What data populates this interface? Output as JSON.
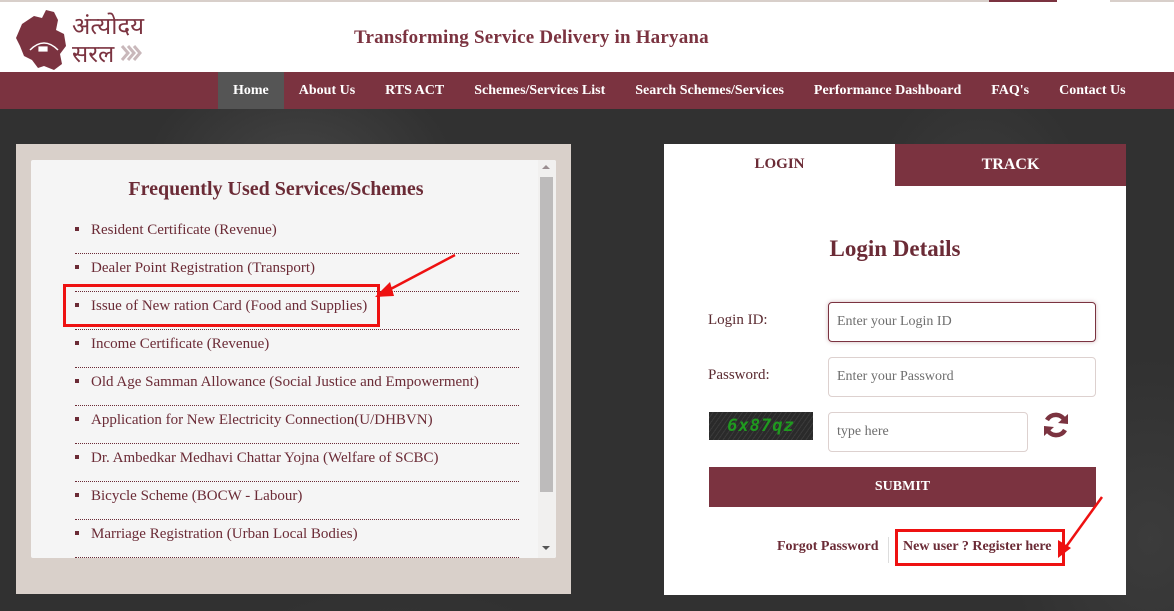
{
  "header": {
    "logo_text_line1": "अंत्योदय",
    "logo_text_line2": "सरल",
    "tagline": "Transforming Service Delivery in Haryana"
  },
  "nav": {
    "items": [
      {
        "label": "Home",
        "active": true
      },
      {
        "label": "About Us"
      },
      {
        "label": "RTS ACT"
      },
      {
        "label": "Schemes/Services List"
      },
      {
        "label": "Search Schemes/Services"
      },
      {
        "label": "Performance Dashboard"
      },
      {
        "label": "FAQ's"
      },
      {
        "label": "Contact Us"
      }
    ]
  },
  "services": {
    "title": "Frequently Used Services/Schemes",
    "items": [
      "Resident Certificate (Revenue)",
      "Dealer Point Registration (Transport)",
      "Issue of New ration Card (Food and Supplies)",
      "Income Certificate (Revenue)",
      "Old Age Samman Allowance (Social Justice and Empowerment)",
      "Application for New Electricity Connection(U/DHBVN)",
      "Dr. Ambedkar Medhavi Chattar Yojna (Welfare of SCBC)",
      "Bicycle Scheme (BOCW - Labour)",
      "Marriage Registration (Urban Local Bodies)"
    ],
    "highlighted_index": 2
  },
  "login": {
    "tabs": {
      "login": "LOGIN",
      "track": "TRACK"
    },
    "active_tab": "login",
    "title": "Login Details",
    "login_id_label": "Login ID:",
    "login_id_placeholder": "Enter your Login ID",
    "password_label": "Password:",
    "password_placeholder": "Enter your Password",
    "captcha_text": "6x87qz",
    "captcha_placeholder": "type here",
    "submit_label": "SUBMIT",
    "forgot_password": "Forgot Password",
    "register": "New user ? Register here"
  },
  "colors": {
    "brand": "#7b3340",
    "nav_active": "#555555",
    "annotation": "#ee1111",
    "captcha_text": "#1f9a1f"
  }
}
